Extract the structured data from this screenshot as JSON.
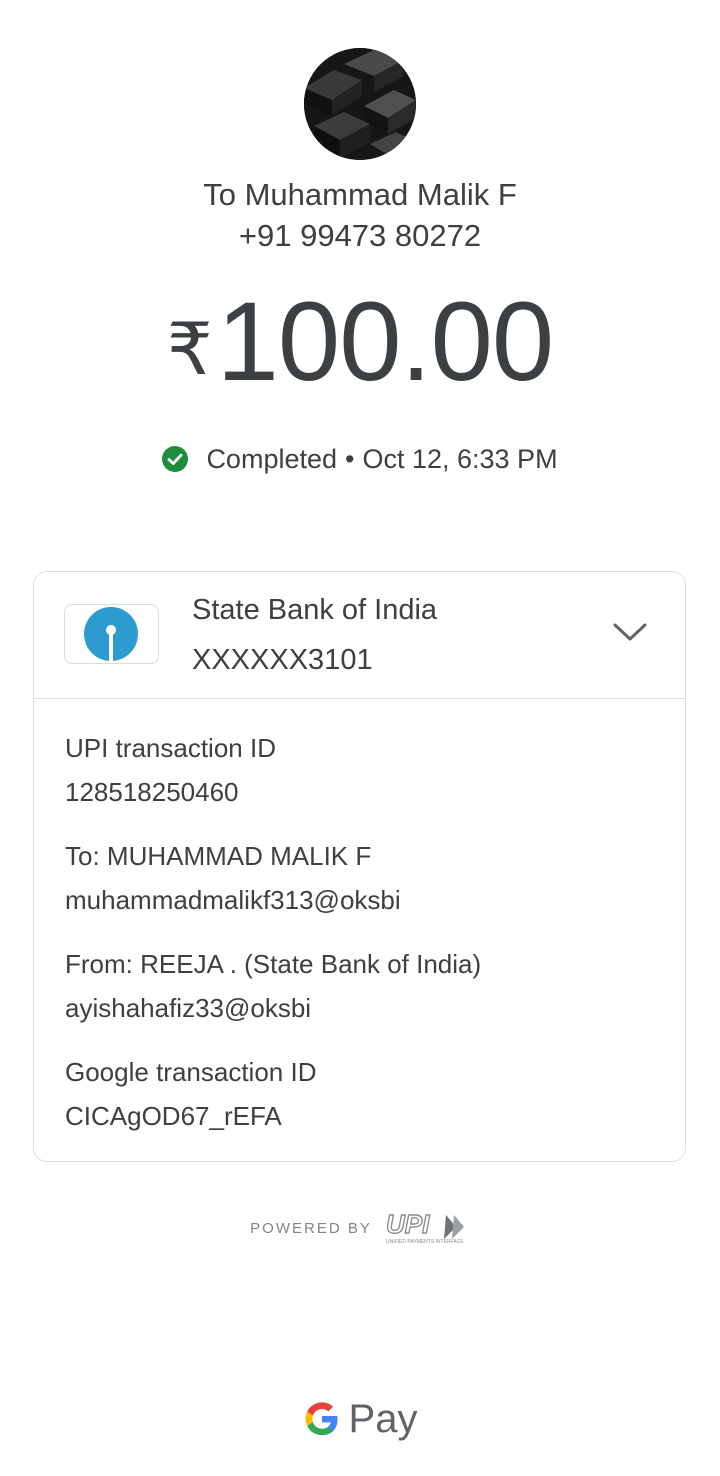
{
  "recipient": {
    "name": "To Muhammad Malik F",
    "phone": "+91 99473 80272"
  },
  "payment": {
    "currency_symbol": "₹",
    "amount": "100.00",
    "status": "Completed",
    "separator": "•",
    "datetime": "Oct 12, 6:33 PM",
    "status_color": "#1e8e3e"
  },
  "bank": {
    "name": "State Bank of India",
    "account": "XXXXXX3101",
    "logo_color": "#2d9bcf"
  },
  "details": {
    "upi_label": "UPI transaction ID",
    "upi_value": "128518250460",
    "to_label": "To: MUHAMMAD MALIK F",
    "to_value": "muhammadmalikf313@oksbi",
    "from_label": "From: REEJA  . (State Bank of India)",
    "from_value": "ayishahafiz33@oksbi",
    "google_label": "Google transaction ID",
    "google_value": "CICAgOD67_rEFA"
  },
  "footer": {
    "powered_by": "POWERED BY",
    "upi_logo_text": "UPI",
    "upi_tagline": "UNIFIED PAYMENTS INTERFACE",
    "gpay_text": "Pay"
  }
}
